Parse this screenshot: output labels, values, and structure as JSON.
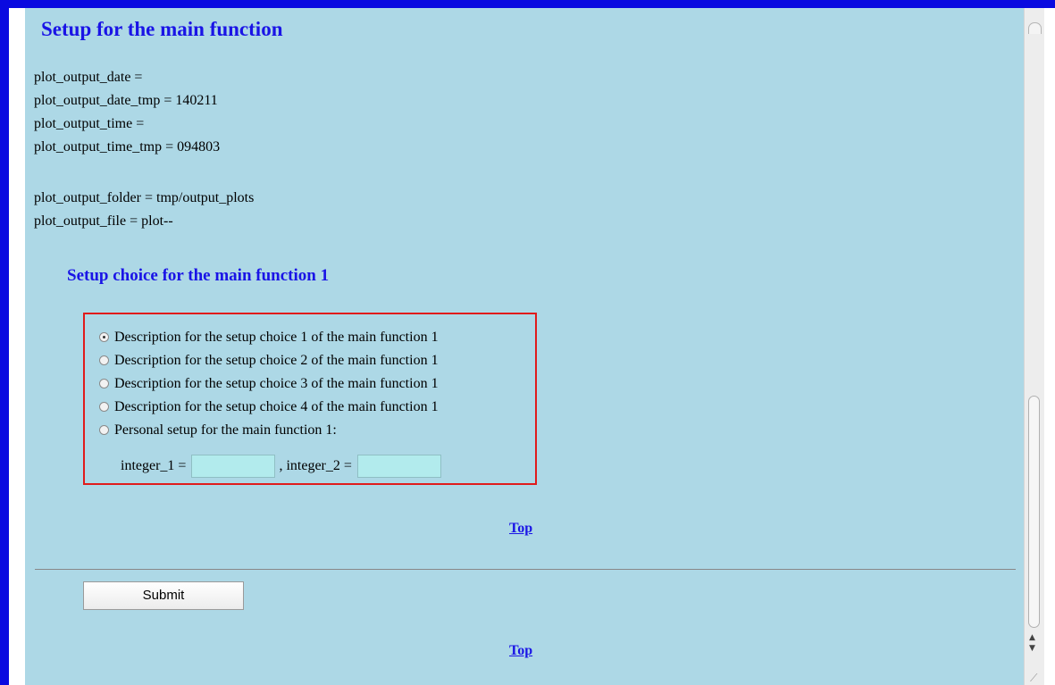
{
  "page": {
    "title": "Setup for the main function",
    "info_lines": [
      "plot_output_date =",
      "plot_output_date_tmp = 140211",
      "plot_output_time =",
      "plot_output_time_tmp = 094803",
      "plot_output_folder = tmp/output_plots",
      "plot_output_file = plot--"
    ],
    "subtitle": "Setup choice for the main function 1",
    "choices": [
      "Description for the setup choice 1 of the main function 1",
      "Description for the setup choice 2 of the main function 1",
      "Description for the setup choice 3 of the main function 1",
      "Description for the setup choice 4 of the main function 1",
      "Personal setup for the main function 1:"
    ],
    "selected_choice": 1,
    "integer_1_label": "integer_1 =",
    "integer_1_value": "",
    "integer_2_label": ", integer_2 =",
    "integer_2_value": "",
    "top_link": "Top",
    "submit_label": "Submit"
  },
  "colors": {
    "frame": "#0a0ae0",
    "content_bg": "#add8e6",
    "heading": "#1a14e6",
    "choice_border": "#e01b1b",
    "input_bg": "#b2ebed"
  }
}
